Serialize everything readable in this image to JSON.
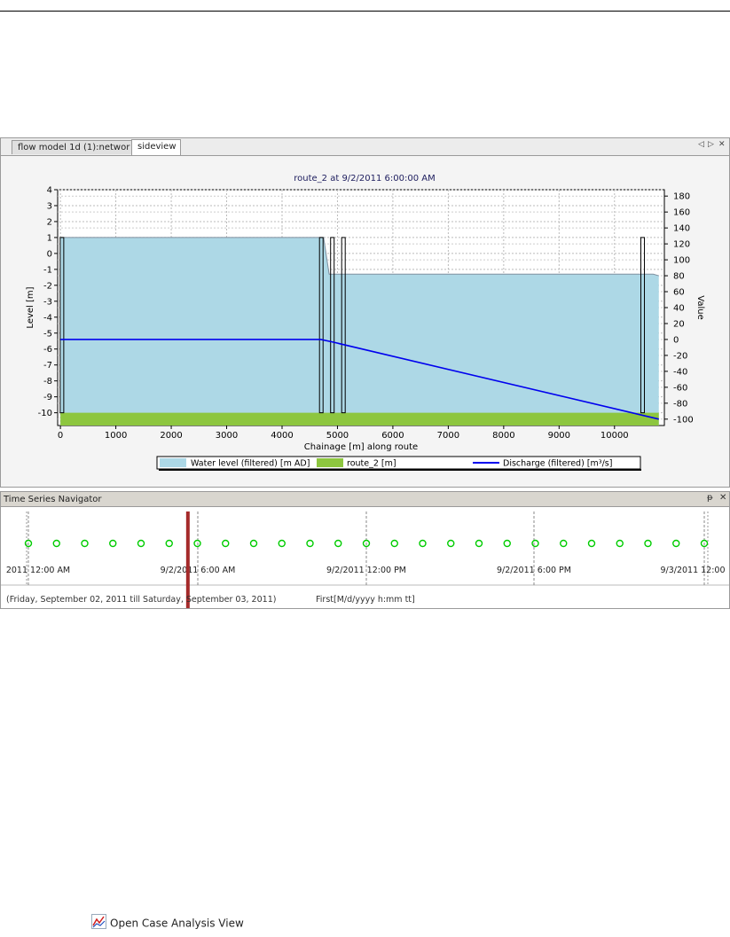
{
  "tabs": [
    {
      "label": "flow model 1d (1):networ"
    },
    {
      "label": "sideview"
    }
  ],
  "tab_controls": {
    "prev": "◁",
    "next": "▷",
    "close": "✕"
  },
  "chart_data": {
    "type": "area",
    "title": "route_2 at 9/2/2011 6:00:00 AM",
    "xlabel": "Chainage [m] along route",
    "ylabel": "Level [m]",
    "y2label": "Value",
    "xlim": [
      -50,
      10900
    ],
    "ylim": [
      -10.8,
      4
    ],
    "y2lim": [
      -108,
      188
    ],
    "xticks": [
      0,
      1000,
      2000,
      3000,
      4000,
      5000,
      6000,
      7000,
      8000,
      9000,
      10000
    ],
    "yticks": [
      4,
      3,
      2,
      1,
      0,
      -1,
      -2,
      -3,
      -4,
      -5,
      -6,
      -7,
      -8,
      -9,
      -10
    ],
    "y2ticks": [
      180,
      160,
      140,
      120,
      100,
      80,
      60,
      40,
      20,
      0,
      -20,
      -40,
      -60,
      -80,
      -100
    ],
    "grid": true,
    "legend_position": "bottom",
    "colors": {
      "water": "#add8e6",
      "bed": "#8dc63f",
      "discharge": "#0000ee",
      "text": "#202060"
    },
    "series": [
      {
        "name": "Water level (filtered) [m AD]",
        "x": [
          0,
          4750,
          4850,
          10700,
          10800
        ],
        "y": [
          1,
          1,
          -1.3,
          -1.3,
          -1.4
        ]
      },
      {
        "name": "route_2 [m]",
        "x": [
          0,
          10800
        ],
        "y": [
          -10,
          -10
        ]
      },
      {
        "name": "Discharge (filtered) [m³/s]",
        "x": [
          0,
          4700,
          4900,
          10800
        ],
        "y": [
          0,
          0,
          -3,
          -100
        ]
      }
    ],
    "structures_x": [
      20,
      4700,
      4900,
      5100,
      10500
    ]
  },
  "navigator": {
    "title": "Time Series Navigator",
    "pin": "ᵽ",
    "close": "✕",
    "axis_labels": [
      "2011 12:00 AM",
      "9/2/2011 6:00 AM",
      "9/2/2011 12:00 PM",
      "9/2/2011 6:00 PM",
      "9/3/2011 12:00"
    ],
    "range_text": "(Friday, September 02, 2011 till Saturday, September 03, 2011)",
    "format_text": "First[M/d/yyyy h:mm tt]",
    "timestep_count": 25,
    "current_fraction": 0.236,
    "colors": {
      "marker": "#00cc00",
      "cursor": "#a52a2a"
    }
  },
  "footer": {
    "open_case_label": "Open Case Analysis View"
  }
}
